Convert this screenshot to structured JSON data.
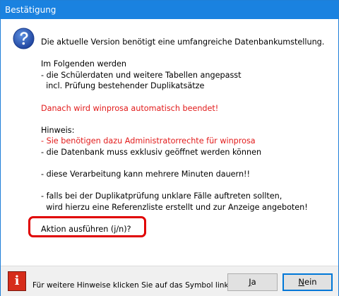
{
  "window": {
    "title": "Bestätigung"
  },
  "message": {
    "intro": "Die aktuelle Version benötigt eine umfangreiche Datenbankumstellung.",
    "following_heading": "Im Folgenden werden",
    "following_1": "- die Schülerdaten und weitere Tabellen angepasst",
    "following_2": "  incl. Prüfung bestehender Duplikatsätze",
    "warning": "Danach wird winprosa automatisch beendet!",
    "hint_heading": "Hinweis:",
    "hint_1": "- Sie benötigen dazu Administratorrechte für winprosa",
    "hint_2": "- die Datenbank muss exklusiv geöffnet werden können",
    "duration": "- diese Verarbeitung kann mehrere Minuten dauern!!",
    "dup_1": "- falls bei der Duplikatprüfung unklare Fälle auftreten sollten,",
    "dup_2": "  wird hierzu eine Referenzliste erstellt und zur Anzeige angeboten!",
    "question": "Aktion ausführen (j/n)?"
  },
  "footer": {
    "info_icon": "i",
    "hint": "Für weitere Hinweise klicken Sie auf das Symbol links",
    "yes_first": "J",
    "yes_rest": "a",
    "no_first": "N",
    "no_rest": "ein"
  },
  "colors": {
    "titlebar": "#1a82e0",
    "warning_text": "#e21b1b",
    "highlight": "#e00000",
    "info_button": "#d62c1a"
  },
  "icons": {
    "dialog": "question-icon",
    "info": "info-icon"
  }
}
